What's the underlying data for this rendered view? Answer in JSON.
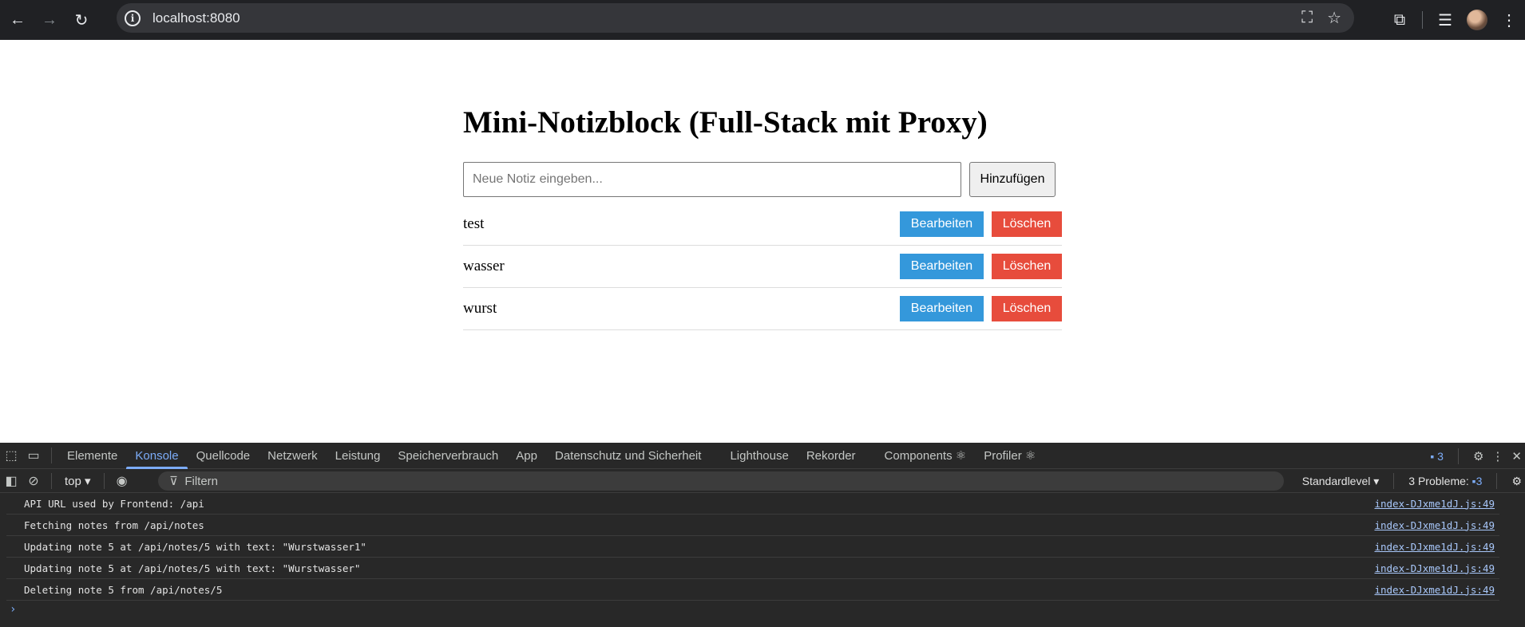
{
  "browser": {
    "url": "localhost:8080"
  },
  "app": {
    "title": "Mini-Notizblock (Full-Stack mit Proxy)",
    "input_placeholder": "Neue Notiz eingeben...",
    "add_label": "Hinzufügen",
    "edit_label": "Bearbeiten",
    "delete_label": "Löschen",
    "notes": [
      "test",
      "wasser",
      "wurst"
    ]
  },
  "devtools": {
    "tabs": [
      "Elemente",
      "Konsole",
      "Quellcode",
      "Netzwerk",
      "Leistung",
      "Speicherverbrauch",
      "App",
      "Datenschutz und Sicherheit",
      "Lighthouse",
      "Rekorder",
      "Components ⚛",
      "Profiler ⚛"
    ],
    "active_tab": "Konsole",
    "issues_count": "3",
    "context": "top",
    "filter_placeholder": "Filtern",
    "level": "Standardlevel",
    "problems": "3 Probleme:",
    "problems_count": "3",
    "logs": [
      {
        "message": "API URL used by Frontend: /api",
        "source": "index-DJxme1dJ.js:49"
      },
      {
        "message": "Fetching notes from /api/notes",
        "source": "index-DJxme1dJ.js:49"
      },
      {
        "message": "Updating note 5 at /api/notes/5 with text: \"Wurstwasser1\"",
        "source": "index-DJxme1dJ.js:49"
      },
      {
        "message": "Updating note 5 at /api/notes/5 with text: \"Wurstwasser\"",
        "source": "index-DJxme1dJ.js:49"
      },
      {
        "message": "Deleting note 5 from /api/notes/5",
        "source": "index-DJxme1dJ.js:49"
      }
    ]
  }
}
